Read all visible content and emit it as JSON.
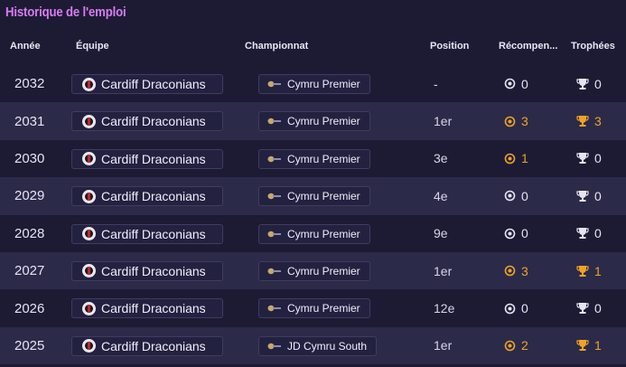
{
  "title": "Historique de l'emploi",
  "columns": {
    "year": "Année",
    "team": "Équipe",
    "league": "Championnat",
    "position": "Position",
    "awards": "Récompen...",
    "trophies": "Trophées"
  },
  "colors": {
    "accent": "#d77cf0",
    "gold": "#f0a323",
    "white": "#e6e4f0"
  },
  "rows": [
    {
      "year": "2032",
      "team": "Cardiff Draconians",
      "league": "Cymru Premier",
      "position": "-",
      "awards": "0",
      "trophies": "0"
    },
    {
      "year": "2031",
      "team": "Cardiff Draconians",
      "league": "Cymru Premier",
      "position": "1er",
      "awards": "3",
      "trophies": "3"
    },
    {
      "year": "2030",
      "team": "Cardiff Draconians",
      "league": "Cymru Premier",
      "position": "3e",
      "awards": "1",
      "trophies": "0"
    },
    {
      "year": "2029",
      "team": "Cardiff Draconians",
      "league": "Cymru Premier",
      "position": "4e",
      "awards": "0",
      "trophies": "0"
    },
    {
      "year": "2028",
      "team": "Cardiff Draconians",
      "league": "Cymru Premier",
      "position": "9e",
      "awards": "0",
      "trophies": "0"
    },
    {
      "year": "2027",
      "team": "Cardiff Draconians",
      "league": "Cymru Premier",
      "position": "1er",
      "awards": "3",
      "trophies": "1"
    },
    {
      "year": "2026",
      "team": "Cardiff Draconians",
      "league": "Cymru Premier",
      "position": "12e",
      "awards": "0",
      "trophies": "0"
    },
    {
      "year": "2025",
      "team": "Cardiff Draconians",
      "league": "JD Cymru South",
      "position": "1er",
      "awards": "2",
      "trophies": "1"
    }
  ]
}
